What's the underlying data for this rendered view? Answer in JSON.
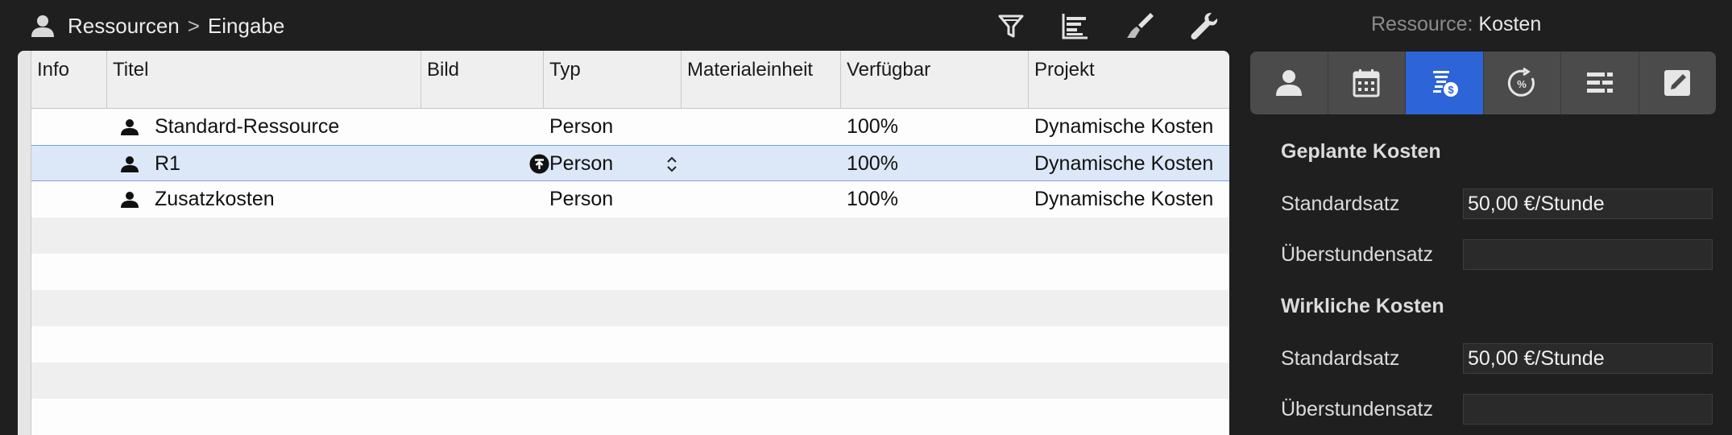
{
  "breadcrumb": {
    "icon": "person-icon",
    "root": "Ressourcen",
    "separator": ">",
    "current": "Eingabe"
  },
  "toolbar": {
    "icons": [
      "filter-icon",
      "gantt-icon",
      "brush-icon",
      "wrench-icon"
    ]
  },
  "inspector": {
    "title_label": "Ressource:",
    "title_value": "Kosten",
    "tabs": [
      "person-icon",
      "calendar-icon",
      "cost-icon",
      "percent-icon",
      "list-icon",
      "edit-icon"
    ],
    "active_tab": "cost-icon",
    "accent": "#2d64d8",
    "planned": {
      "heading": "Geplante Kosten",
      "standard_label": "Standardsatz",
      "standard_value": "50,00 €/Stunde",
      "overtime_label": "Überstundensatz",
      "overtime_value": ""
    },
    "actual": {
      "heading": "Wirkliche Kosten",
      "standard_label": "Standardsatz",
      "standard_value": "50,00 €/Stunde",
      "overtime_label": "Überstundensatz",
      "overtime_value": ""
    }
  },
  "table": {
    "columns": [
      "Info",
      "Titel",
      "Bild",
      "Typ",
      "Materialeinheit",
      "Verfügbar",
      "Projekt"
    ],
    "rows": [
      {
        "title": "Standard-Ressource",
        "type": "Person",
        "available": "100%",
        "project": "Dynamische Kosten",
        "selected": false
      },
      {
        "title": "R1",
        "type": "Person",
        "available": "100%",
        "project": "Dynamische Kosten",
        "selected": true
      },
      {
        "title": "Zusatzkosten",
        "type": "Person",
        "available": "100%",
        "project": "Dynamische Kosten",
        "selected": false
      }
    ],
    "selection_color": "#dce7f7"
  }
}
